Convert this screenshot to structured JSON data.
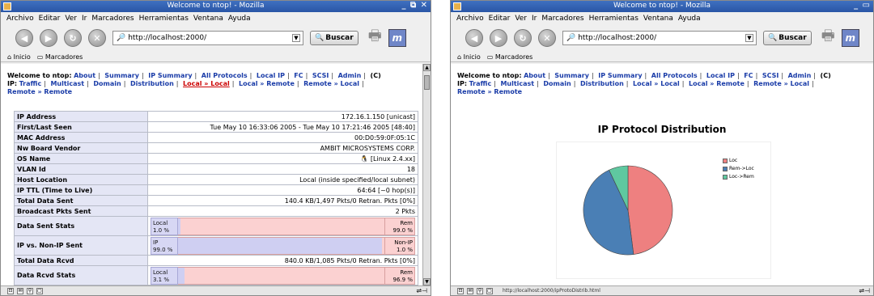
{
  "browser": {
    "title": "Welcome to ntop! - Mozilla",
    "window_controls": "_ ⧉ ✕",
    "menu": [
      "Archivo",
      "Editar",
      "Ver",
      "Ir",
      "Marcadores",
      "Herramientas",
      "Ventana",
      "Ayuda"
    ],
    "url": "http://localhost:2000/",
    "search_button": "Buscar",
    "throbber_label": "m",
    "bookmarks": [
      "Inicio",
      "Marcadores"
    ]
  },
  "ntop_menu": {
    "welcome": "Welcome to ntop:",
    "top": [
      "About",
      "Summary",
      "IP Summary",
      "All Protocols",
      "Local IP",
      "FC",
      "SCSI",
      "Admin",
      "(C)"
    ],
    "ip_label": "IP:",
    "ip_items": [
      "Traffic",
      "Multicast",
      "Domain",
      "Distribution",
      "Local » Local",
      "Local » Remote",
      "Remote » Local",
      "Remote » Remote"
    ]
  },
  "host_table": {
    "rows": [
      {
        "label": "IP Address",
        "value": "172.16.1.150  [unicast]"
      },
      {
        "label": "First/Last Seen",
        "value": "Tue May 10 16:33:06 2005  -  Tue May 10 17:21:46 2005 [48:40]"
      },
      {
        "label": "MAC Address ",
        "value": "00:D0:59:0F:05:1C"
      },
      {
        "label": "Nw Board Vendor",
        "value": "AMBIT MICROSYSTEMS CORP."
      },
      {
        "label": "OS Name",
        "value": "🐧 [Linux 2.4.xx]"
      },
      {
        "label": "VLAN Id",
        "value": "18"
      },
      {
        "label": "Host Location",
        "value": "Local (inside specified/local subnet)"
      },
      {
        "label": "IP TTL (Time to Live)",
        "value": "64:64 [~0 hop(s)]"
      },
      {
        "label": "Total Data Sent",
        "value": "140.4 KB/1,497 Pkts/0 Retran. Pkts [0%]"
      },
      {
        "label": "Broadcast Pkts Sent",
        "value": "2 Pkts"
      }
    ],
    "data_sent_stats": {
      "label": "Data Sent Stats",
      "left_name": "Local",
      "left_pct": "1.0 %",
      "right_name": "Rem",
      "right_pct": "99.0 %",
      "fill": 0.01
    },
    "ip_vs_nonip": {
      "label": "IP vs. Non-IP Sent",
      "left_name": "IP",
      "left_pct": "99.0 %",
      "right_name": "Non-IP",
      "right_pct": "1.0 %",
      "fill": 0.99
    },
    "total_data_rcvd": {
      "label": "Total Data Rcvd",
      "value": "840.0 KB/1,085 Pkts/0 Retran. Pkts [0%]"
    },
    "data_rcvd_stats": {
      "label": "Data Rcvd Stats",
      "left_name": "Local",
      "left_pct": "3.1 %",
      "right_name": "Rem",
      "right_pct": "96.9 %",
      "fill": 0.031
    }
  },
  "status": {
    "url_text": "http://localhost:2000/ipProtoDistrib.html",
    "icons": [
      "⊡",
      "✉",
      "⚲",
      "▢"
    ]
  },
  "chart_page": {
    "heading": "IP Protocol Distribution"
  },
  "chart_data": {
    "type": "pie",
    "labels": [
      "Loc",
      "Rem->Loc",
      "Loc->Rem"
    ],
    "values": [
      48,
      45,
      7
    ],
    "colors": [
      "#ee8080",
      "#4a7fb5",
      "#5fc8a0"
    ]
  }
}
